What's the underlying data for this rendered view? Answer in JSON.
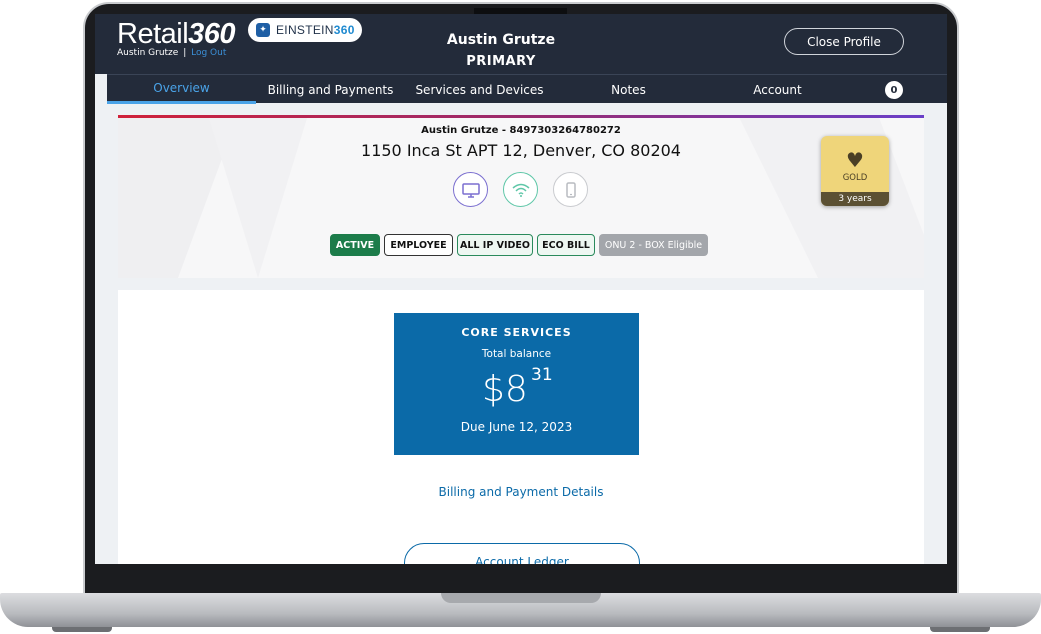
{
  "app": {
    "brand_prefix": "Retail",
    "brand_number": "360",
    "einstein_prefix": "EINSTEIN",
    "einstein_number": "360",
    "user_name": "Austin Grutze",
    "separator": "|",
    "logout_label": "Log Out"
  },
  "profile_header": {
    "name": "Austin Grutze",
    "role": "PRIMARY",
    "close_label": "Close Profile"
  },
  "tabs": [
    {
      "label": "Overview",
      "active": true
    },
    {
      "label": "Billing and Payments",
      "active": false
    },
    {
      "label": "Services and Devices",
      "active": false
    },
    {
      "label": "Notes",
      "active": false
    },
    {
      "label": "Account",
      "active": false
    }
  ],
  "notification_count": "0",
  "profile_card": {
    "account_line": "Austin Grutze - 8497303264780272",
    "address": "1150 Inca St APT 12, Denver, CO 80204",
    "service_icons": [
      {
        "icon": "tv-icon",
        "color": "#7b6fd0"
      },
      {
        "icon": "wifi-icon",
        "color": "#5fc7a8"
      },
      {
        "icon": "phone-icon",
        "color": "#b9bcc1"
      }
    ],
    "tags": [
      {
        "label": "ACTIVE",
        "style": "solid-green"
      },
      {
        "label": "EMPLOYEE",
        "style": "outline-dark"
      },
      {
        "label": "ALL IP VIDEO",
        "style": "outline-green"
      },
      {
        "label": "ECO BILL",
        "style": "outline-green"
      },
      {
        "label": "ONU 2 - BOX Eligible",
        "style": "solid-gray"
      }
    ],
    "loyalty": {
      "tier": "GOLD",
      "tenure": "3 years",
      "icon": "heart-icon"
    }
  },
  "balance": {
    "title": "CORE SERVICES",
    "subtitle": "Total balance",
    "dollars": "$8",
    "cents": "31",
    "due": "Due June 12, 2023"
  },
  "links": {
    "billing_details": "Billing and Payment Details",
    "account_ledger": "Account Ledger"
  },
  "colors": {
    "header_bg": "#232b3a",
    "active_tab": "#4aa3e8",
    "balance_bg": "#0b6aa8",
    "tag_green": "#1c7c4a",
    "gold": "#efd57a"
  }
}
